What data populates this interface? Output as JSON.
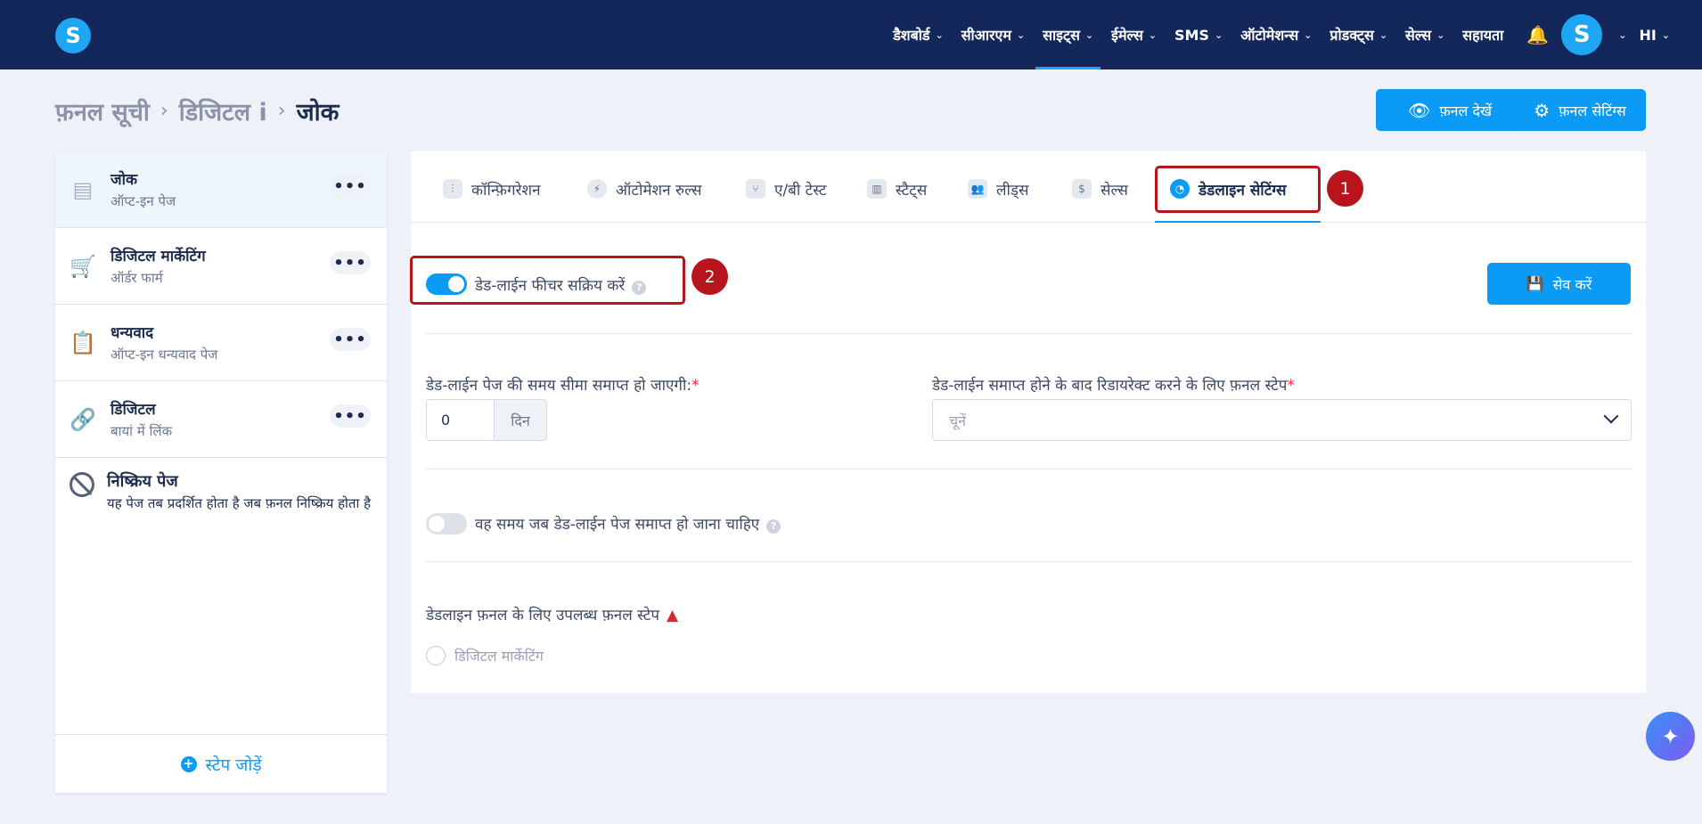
{
  "nav": {
    "items": [
      {
        "label": "डैशबोर्ड"
      },
      {
        "label": "सीआरएम"
      },
      {
        "label": "साइट्स"
      },
      {
        "label": "ईमेल्स"
      },
      {
        "label": "SMS"
      },
      {
        "label": "ऑटोमेशन्स"
      },
      {
        "label": "प्रोडक्ट्स"
      },
      {
        "label": "सेल्स"
      },
      {
        "label": "सहायता"
      }
    ],
    "logo_letter": "S",
    "avatar_letter": "S",
    "language": "HI"
  },
  "breadcrumb": {
    "items": [
      "फ़नल सूची",
      "डिजिटल i",
      "जोक"
    ]
  },
  "header_buttons": {
    "view_funnel": "फ़नल देखें",
    "funnel_settings": "फ़नल सेटिंग्स"
  },
  "sidebar": {
    "steps": [
      {
        "title": "जोक",
        "subtitle": "ऑप्ट-इन पेज"
      },
      {
        "title": "डिजिटल मार्केटिंग",
        "subtitle": "ऑर्डर फार्म"
      },
      {
        "title": "धन्यवाद",
        "subtitle": "ऑप्ट-इन धन्यवाद पेज"
      },
      {
        "title": "डिजिटल",
        "subtitle": "बायां में लिंक"
      }
    ],
    "inactive": {
      "title": "निष्क्रिय पेज",
      "subtitle": "यह पेज तब प्रदर्शित होता है जब फ़नल निष्क्रिय होता है"
    },
    "add_step": "स्टेप जोड़ें"
  },
  "tabs": [
    {
      "label": "कॉन्फ़िगरेशन"
    },
    {
      "label": "ऑटोमेशन रुल्स"
    },
    {
      "label": "ए/बी टेस्ट"
    },
    {
      "label": "स्टैट्स"
    },
    {
      "label": "लीड्स"
    },
    {
      "label": "सेल्स"
    },
    {
      "label": "डेडलाइन सेटिंग्स"
    }
  ],
  "annotations": {
    "badge1": "1",
    "badge2": "2"
  },
  "deadline": {
    "enable_label": "डेड-लाईन फीचर सक्रिय करें",
    "enable_on": true,
    "save_label": "सेव करें",
    "expire_label": "डेड-लाईन पेज की समय सीमा समाप्त हो जाएगी:",
    "expire_value": "0",
    "expire_unit": "दिन",
    "redirect_label": "डेड-लाईन समाप्त होने के बाद रिडायरेक्ट करने के लिए फ़नल स्टेप",
    "redirect_placeholder": "चूनें",
    "required_mark": "*",
    "time_label": "वह समय जब डेड-लाईन पेज समाप्त हो जाना चाहिए",
    "time_on": false,
    "available_label": "डेडलाइन फ़नल के लिए उपलब्ध फ़नल स्टेप",
    "available_option": "डिजिटल मार्केटिंग"
  },
  "colors": {
    "navbar": "#14275a",
    "accent": "#0b9af5",
    "highlight": "#b8141b"
  }
}
